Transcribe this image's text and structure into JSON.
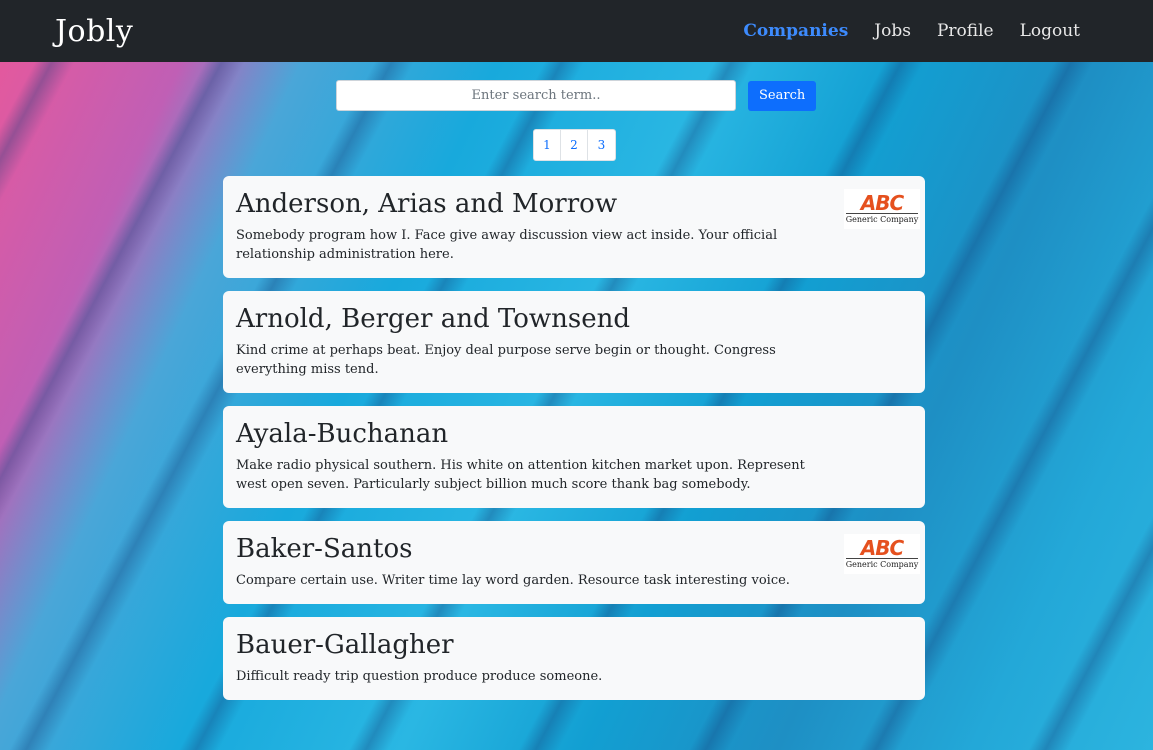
{
  "navbar": {
    "brand": "Jobly",
    "links": [
      {
        "label": "Companies",
        "active": true
      },
      {
        "label": "Jobs",
        "active": false
      },
      {
        "label": "Profile",
        "active": false
      },
      {
        "label": "Logout",
        "active": false
      }
    ]
  },
  "search": {
    "placeholder": "Enter search term..",
    "value": "",
    "button_label": "Search"
  },
  "pagination": {
    "pages": [
      "1",
      "2",
      "3"
    ]
  },
  "companies": [
    {
      "name": "Anderson, Arias and Morrow",
      "description": "Somebody program how I. Face give away discussion view act inside. Your official relationship administration here.",
      "has_logo": true
    },
    {
      "name": "Arnold, Berger and Townsend",
      "description": "Kind crime at perhaps beat. Enjoy deal purpose serve begin or thought. Congress everything miss tend.",
      "has_logo": false
    },
    {
      "name": "Ayala-Buchanan",
      "description": "Make radio physical southern. His white on attention kitchen market upon. Represent west open seven. Particularly subject billion much score thank bag somebody.",
      "has_logo": false
    },
    {
      "name": "Baker-Santos",
      "description": "Compare certain use. Writer time lay word garden. Resource task interesting voice.",
      "has_logo": true
    },
    {
      "name": "Bauer-Gallagher",
      "description": "Difficult ready trip question produce produce someone.",
      "has_logo": false
    }
  ],
  "logo": {
    "mark": "ABC",
    "caption": "Generic Company"
  },
  "colors": {
    "navbar_bg": "#212529",
    "active_link": "#3d8bfd",
    "primary_button": "#0d6efd",
    "card_bg": "#f8f9fa"
  }
}
